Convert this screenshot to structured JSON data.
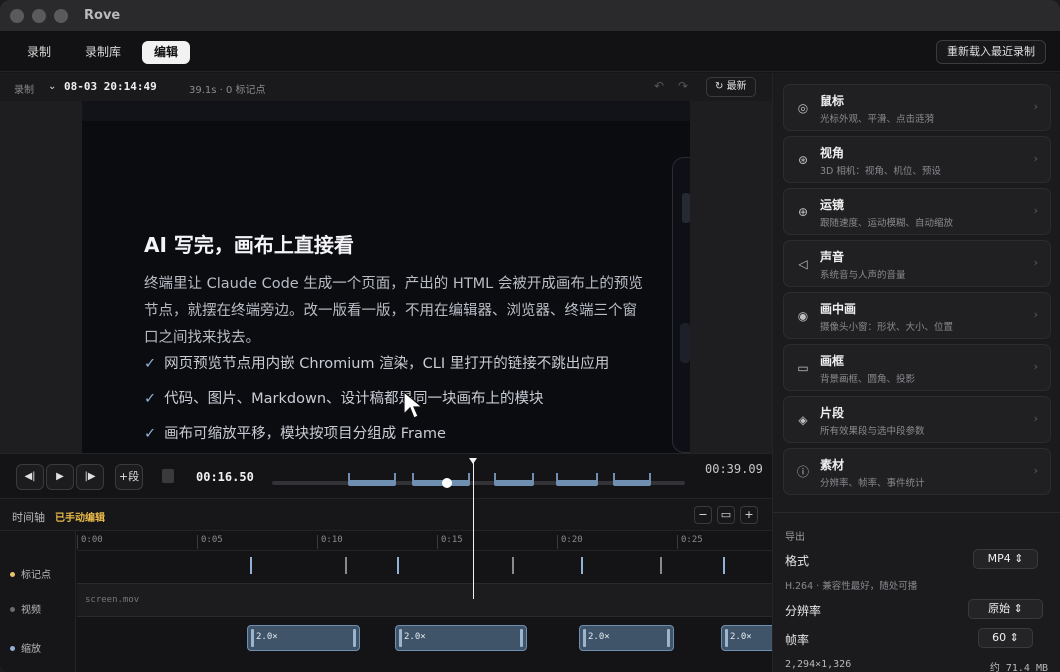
{
  "window": {
    "title": "Rove"
  },
  "toolbar": {
    "tabs": [
      {
        "label": "录制",
        "active": false
      },
      {
        "label": "录制库",
        "active": false
      },
      {
        "label": "编辑",
        "active": true
      }
    ],
    "reload_label": "重新载入最近录制"
  },
  "recording_bar": {
    "label": "录制",
    "date": "08-03 20:14:49",
    "meta": "39.1s · 0 标记点",
    "latest_label": "最新"
  },
  "slide": {
    "title": "AI 写完，画布上直接看",
    "body": "终端里让 Claude Code 生成一个页面，产出的 HTML 会被开成画布上的预览节点，就摆在终端旁边。改一版看一版，不用在编辑器、浏览器、终端三个窗口之间找来找去。",
    "bullets": [
      "网页预览节点用内嵌 Chromium 渲染，CLI 里打开的链接不跳出应用",
      "代码、图片、Markdown、设计稿都是同一块画布上的模块",
      "画布可缩放平移，模块按项目分组成 Frame"
    ]
  },
  "transport": {
    "add_segment_label": "+段",
    "current_time": "00:16.50",
    "duration": "00:39.09",
    "progress": 0.42
  },
  "timeline": {
    "label": "时间轴",
    "badge": "已手动编辑",
    "ruler": [
      "0:00",
      "0:05",
      "0:10",
      "0:15",
      "0:20",
      "0:25"
    ],
    "tracks": [
      {
        "label": "标记点",
        "color": "#e9c46a"
      },
      {
        "label": "视频",
        "color": "#6b6b6f"
      },
      {
        "label": "缩放",
        "color": "#8fb2d6"
      }
    ],
    "video_file": "screen.mov",
    "zoom_segments": [
      {
        "label": "2.0×"
      },
      {
        "label": "2.0×"
      },
      {
        "label": "2.0×"
      },
      {
        "label": "2.0×"
      }
    ]
  },
  "sidebar": {
    "cards": [
      {
        "title": "鼠标",
        "sub": "光标外观、平滑、点击涟漪",
        "icon": "cursor-icon",
        "glyph": "◎"
      },
      {
        "title": "视角",
        "sub": "3D 相机：视角、机位、预设",
        "icon": "camera-icon",
        "glyph": "⊛"
      },
      {
        "title": "运镜",
        "sub": "跟随速度、运动模糊、自动缩放",
        "icon": "zoom-icon",
        "glyph": "⊕"
      },
      {
        "title": "声音",
        "sub": "系统音与人声的音量",
        "icon": "speaker-icon",
        "glyph": "◁"
      },
      {
        "title": "画中画",
        "sub": "摄像头小窗：形状、大小、位置",
        "icon": "webcam-icon",
        "glyph": "◉"
      },
      {
        "title": "画框",
        "sub": "背景画框、圆角、投影",
        "icon": "frame-icon",
        "glyph": "▭"
      },
      {
        "title": "片段",
        "sub": "所有效果段与选中段参数",
        "icon": "layers-icon",
        "glyph": "◈"
      },
      {
        "title": "素材",
        "sub": "分辨率、帧率、事件统计",
        "icon": "info-icon",
        "glyph": "ⓘ"
      }
    ],
    "export": {
      "title": "导出",
      "format_label": "格式",
      "format_value": "MP4",
      "format_note": "H.264 · 兼容性最好，随处可播",
      "resolution_label": "分辨率",
      "resolution_value": "原始",
      "fps_label": "帧率",
      "fps_value": "60",
      "dimensions": "2,294×1,326",
      "size": "约 71.4 MB"
    }
  }
}
